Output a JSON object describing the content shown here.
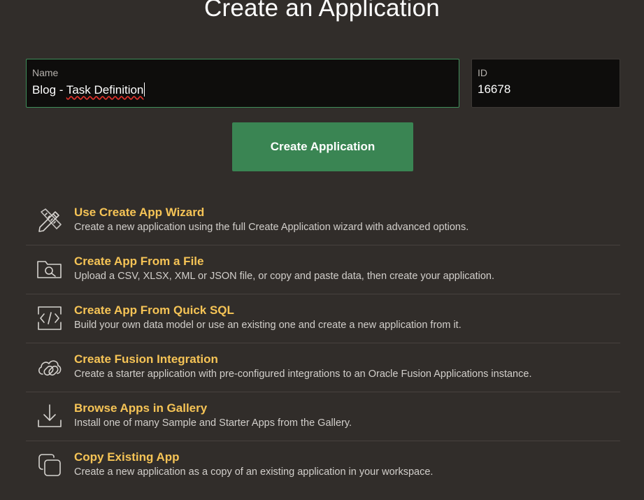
{
  "page": {
    "title": "Create an Application"
  },
  "form": {
    "name_label": "Name",
    "name_value_prefix": "Blog - ",
    "name_value_misspelled": "Task Definition",
    "id_label": "ID",
    "id_value": "16678",
    "create_button_label": "Create Application"
  },
  "options": [
    {
      "icon": "wizard-tools-icon",
      "title": "Use Create App Wizard",
      "description": "Create a new application using the full Create Application wizard with advanced options."
    },
    {
      "icon": "folder-search-icon",
      "title": "Create App From a File",
      "description": "Upload a CSV, XLSX, XML or JSON file, or copy and paste data, then create your application."
    },
    {
      "icon": "code-icon",
      "title": "Create App From Quick SQL",
      "description": "Build your own data model or use an existing one and create a new application from it."
    },
    {
      "icon": "cloud-link-icon",
      "title": "Create Fusion Integration",
      "description": "Create a starter application with pre-configured integrations to an Oracle Fusion Applications instance."
    },
    {
      "icon": "download-icon",
      "title": "Browse Apps in Gallery",
      "description": "Install one of many Sample and Starter Apps from the Gallery."
    },
    {
      "icon": "copy-icon",
      "title": "Copy Existing App",
      "description": "Create a new application as a copy of an existing application in your workspace."
    }
  ],
  "colors": {
    "background": "#312d2a",
    "field_background": "#0e0d0c",
    "focus_border": "#3f8e5a",
    "primary_button": "#3a8553",
    "option_title": "#f6c456"
  }
}
